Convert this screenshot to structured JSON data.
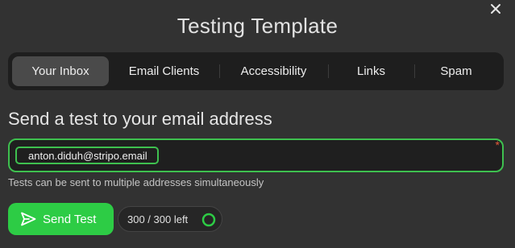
{
  "dialog": {
    "title": "Testing Template",
    "close_icon": "close-icon"
  },
  "tabs": [
    {
      "label": "Your Inbox",
      "active": true
    },
    {
      "label": "Email Clients",
      "active": false
    },
    {
      "label": "Accessibility",
      "active": false
    },
    {
      "label": "Links",
      "active": false
    },
    {
      "label": "Spam",
      "active": false
    }
  ],
  "section": {
    "heading": "Send a test to your email address"
  },
  "email_field": {
    "recipients": [
      "anton.diduh@stripo.email"
    ],
    "required_marker": "*",
    "hint": "Tests can be sent to multiple addresses simultaneously"
  },
  "actions": {
    "send_label": "Send Test",
    "send_icon": "send-icon",
    "quota_text": "300 / 300 left",
    "quota_remaining_fraction": 1.0
  },
  "colors": {
    "accent": "#2dcc45",
    "border_green": "#3ec04f",
    "background": "#323232",
    "required": "#e05a3a"
  }
}
